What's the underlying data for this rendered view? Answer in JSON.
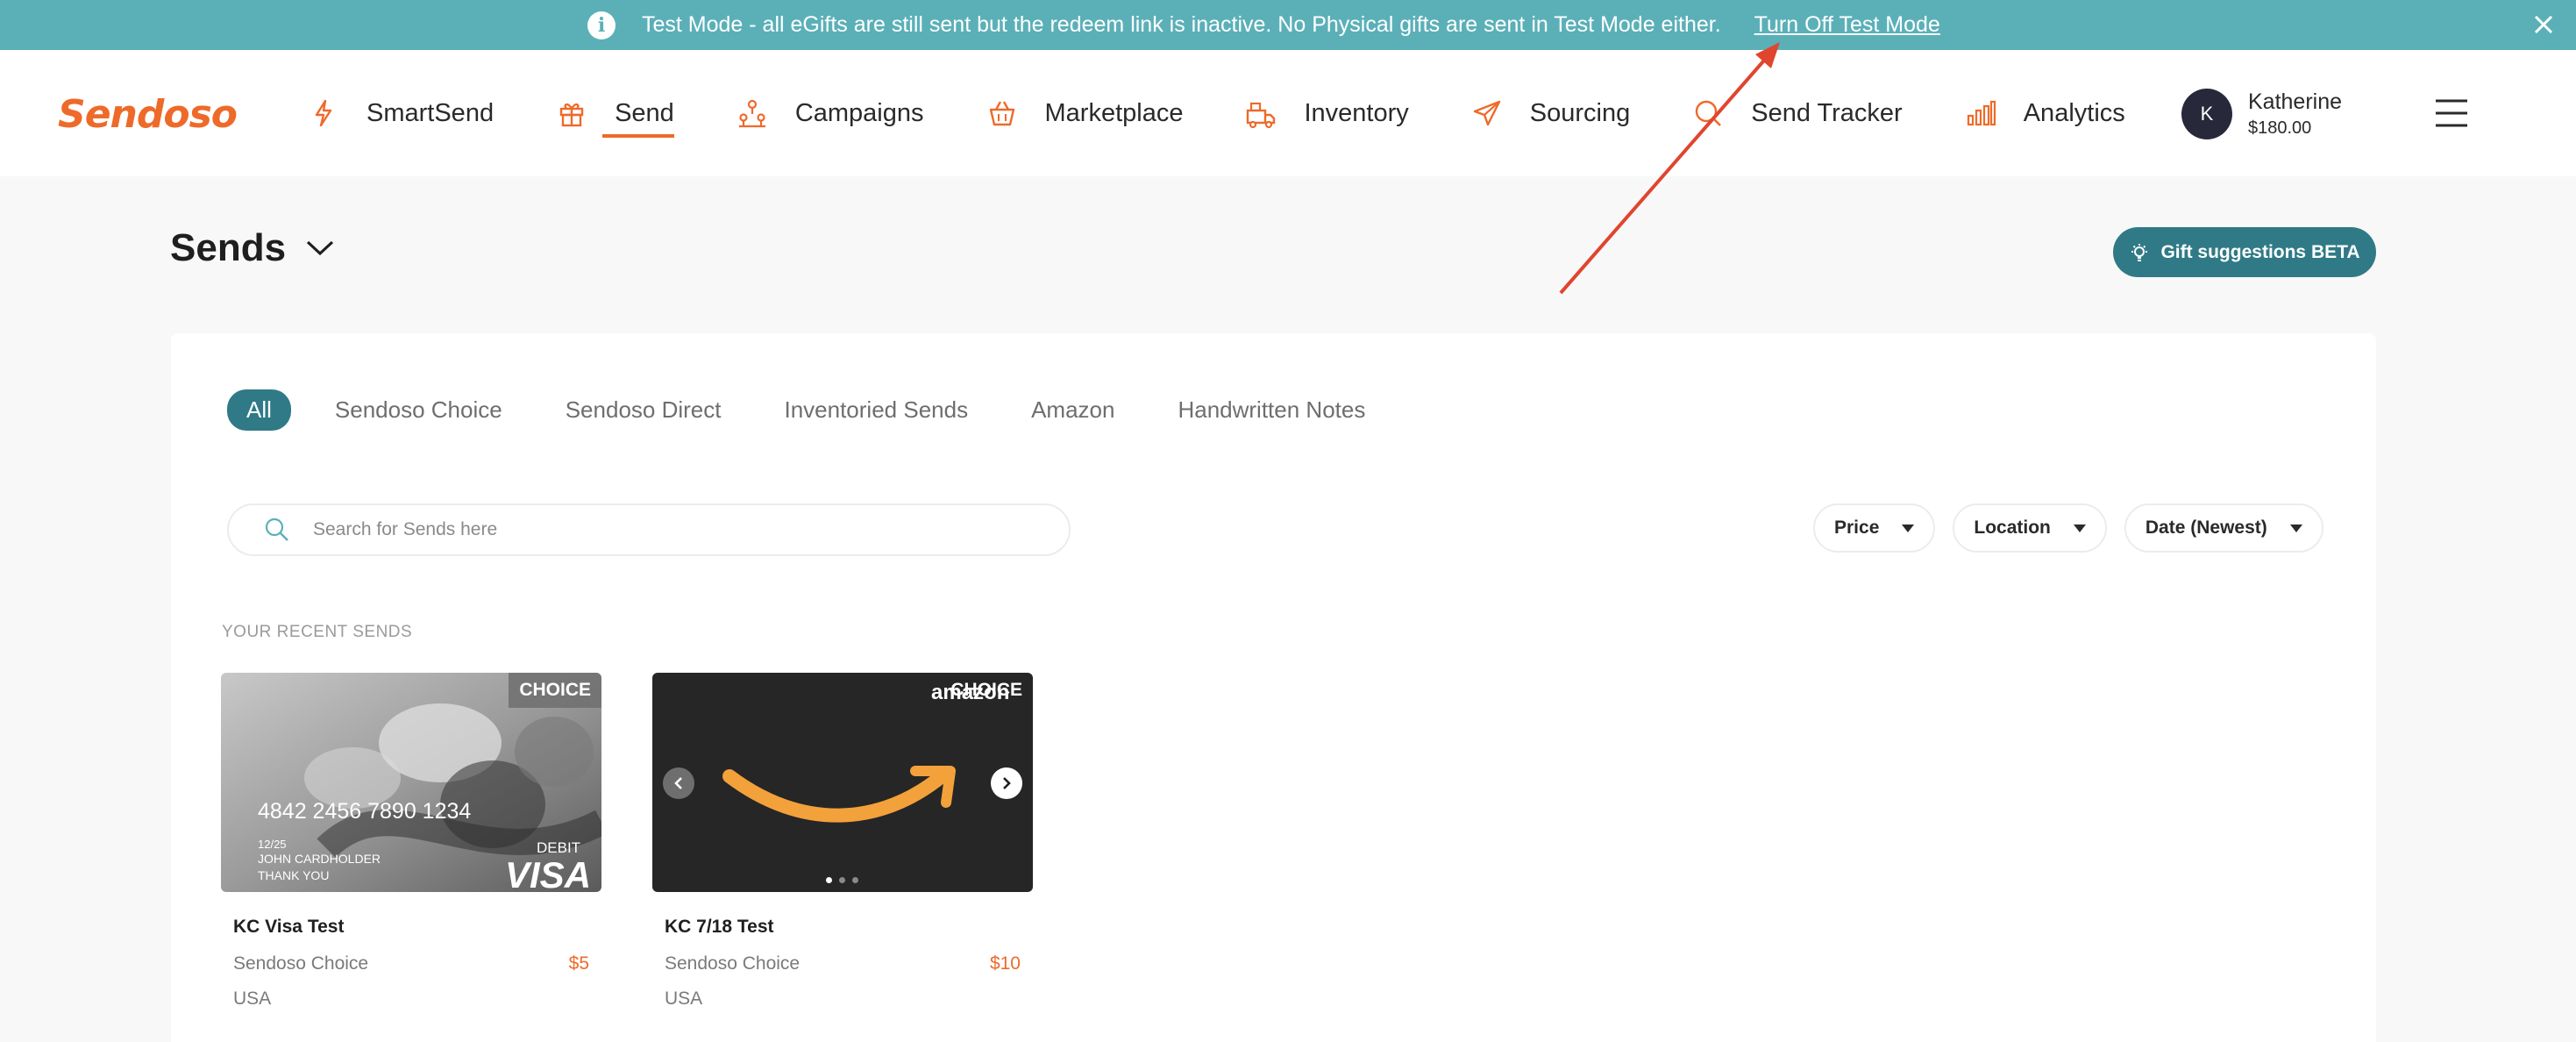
{
  "banner": {
    "info_icon": "info-icon",
    "text": "Test Mode - all eGifts are still sent but the redeem link is inactive. No Physical gifts are sent in Test Mode either.",
    "link": "Turn Off Test Mode",
    "close_icon": "close-icon",
    "color": "#5bb0b8"
  },
  "header": {
    "logo": "Sendoso",
    "nav": [
      {
        "label": "SmartSend",
        "icon": "bolt-icon"
      },
      {
        "label": "Send",
        "icon": "gift-icon",
        "active": true
      },
      {
        "label": "Campaigns",
        "icon": "campaigns-icon"
      },
      {
        "label": "Marketplace",
        "icon": "basket-icon"
      },
      {
        "label": "Inventory",
        "icon": "inventory-icon"
      },
      {
        "label": "Sourcing",
        "icon": "paper-plane-icon"
      },
      {
        "label": "Send Tracker",
        "icon": "search-icon"
      },
      {
        "label": "Analytics",
        "icon": "bar-chart-icon"
      }
    ],
    "user": {
      "initial": "K",
      "name": "Katherine",
      "balance": "$180.00"
    },
    "menu_icon": "hamburger-menu-icon",
    "accent": "#ee6a2a"
  },
  "page": {
    "title": "Sends",
    "gift_suggestions": "Gift suggestions BETA"
  },
  "tabs": [
    "All",
    "Sendoso Choice",
    "Sendoso Direct",
    "Inventoried Sends",
    "Amazon",
    "Handwritten Notes"
  ],
  "search": {
    "placeholder": "Search for Sends here"
  },
  "filters": [
    "Price",
    "Location",
    "Date (Newest)"
  ],
  "recent": {
    "label": "YOUR RECENT SENDS",
    "cards": [
      {
        "name": "KC Visa Test",
        "type": "Sendoso Choice",
        "price": "$5",
        "country": "USA",
        "badge": "CHOICE",
        "card_number": "4842 2456 7890 1234",
        "card_valid": "12/25",
        "card_holder": "JOHN CARDHOLDER",
        "card_thanks": "THANK YOU",
        "card_debit": "DEBIT",
        "card_brand": "VISA"
      },
      {
        "name": "KC 7/18 Test",
        "type": "Sendoso Choice",
        "price": "$10",
        "country": "USA",
        "badge": "CHOICE",
        "brand": "amazon"
      }
    ]
  },
  "brand_color": "#2f7a86"
}
